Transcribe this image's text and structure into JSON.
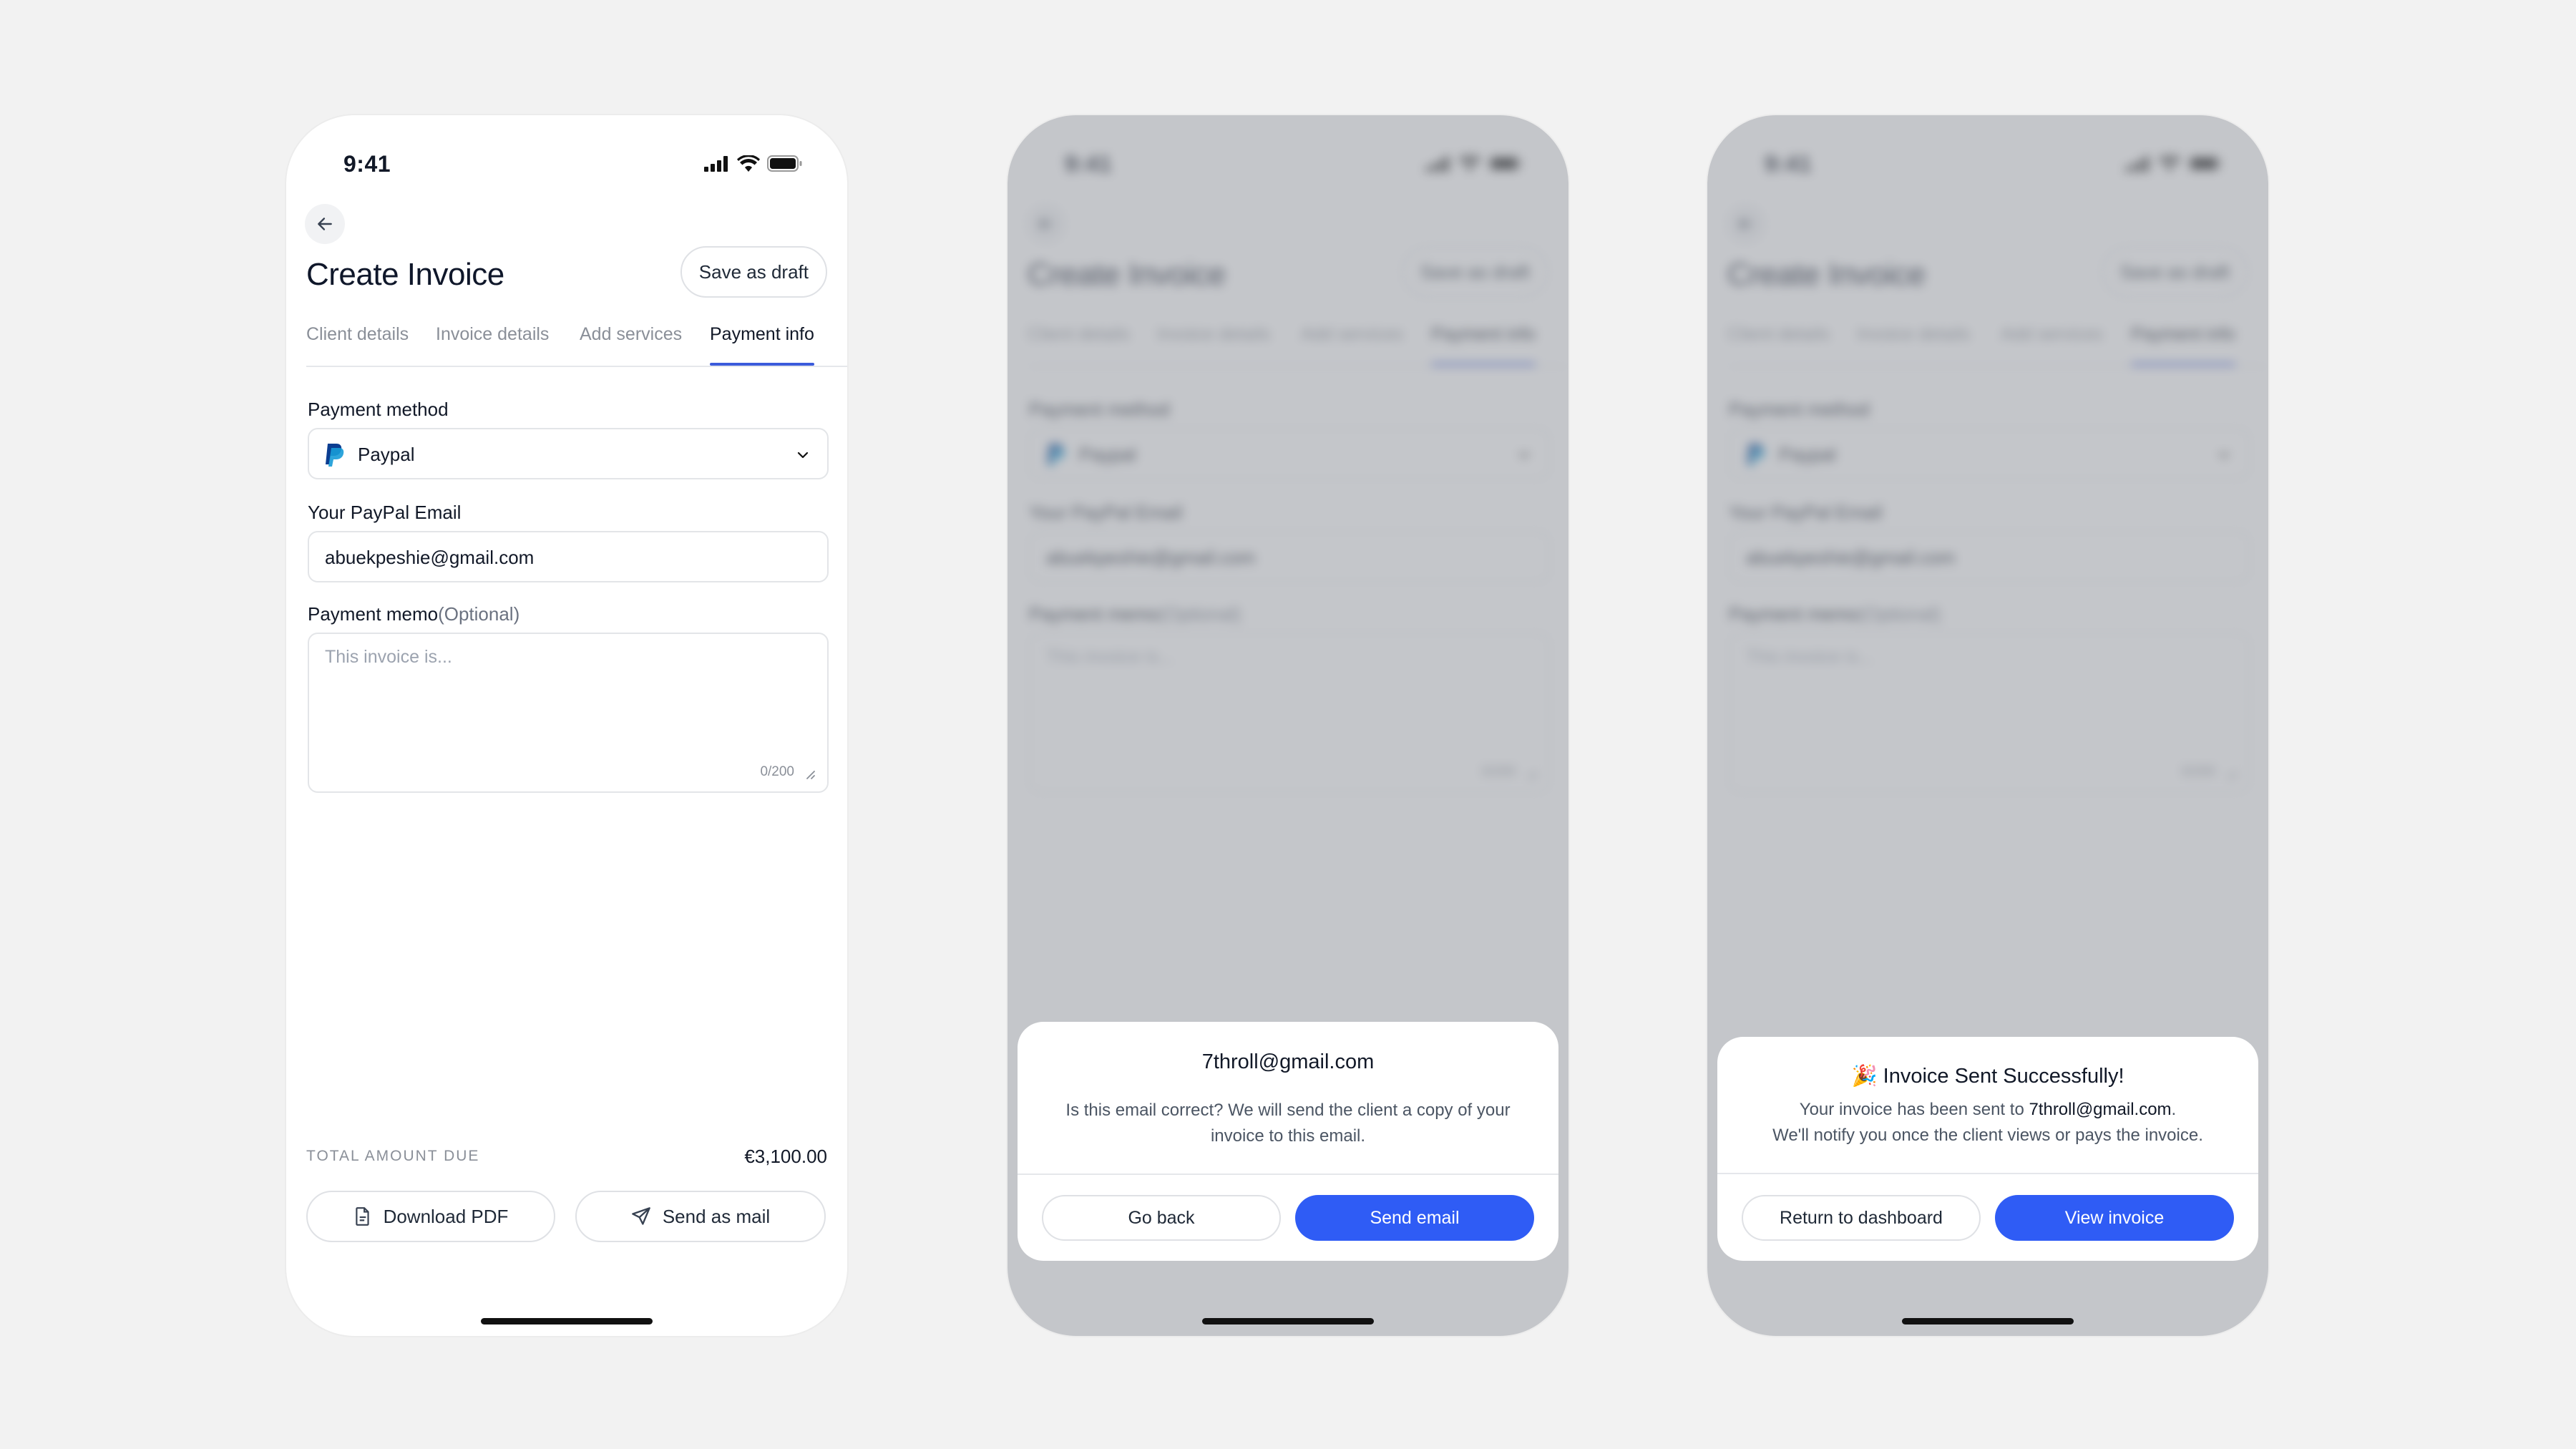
{
  "status": {
    "time": "9:41"
  },
  "screen": {
    "title": "Create Invoice",
    "draft_button": "Save as draft",
    "tabs": [
      "Client details",
      "Invoice details",
      "Add services",
      "Payment info"
    ],
    "payment_method_label": "Payment method",
    "payment_method_value": "Paypal",
    "paypal_email_label": "Your PayPal Email",
    "paypal_email_value": "abuekpeshie@gmail.com",
    "memo_label": "Payment memo",
    "memo_optional": "(Optional)",
    "memo_placeholder": "This invoice is...",
    "memo_counter": "0/200",
    "total_label": "TOTAL AMOUNT DUE",
    "total_value": "€3,100.00",
    "download_button": "Download PDF",
    "send_mail_button": "Send as mail"
  },
  "confirm_sheet": {
    "email": "7throll@gmail.com",
    "message_line1": "Is this email correct? We will send the client a copy of your",
    "message_line2": "invoice to this email.",
    "back_button": "Go back",
    "send_button": "Send email"
  },
  "success_sheet": {
    "emoji": "🎉",
    "title": "Invoice Sent Successfully!",
    "line1_prefix": "Your invoice has been sent to ",
    "line1_email": "7throll@gmail.com",
    "line1_suffix": ".",
    "line2": "We'll notify you once the client views or pays the invoice.",
    "dashboard_button": "Return to dashboard",
    "view_button": "View invoice"
  },
  "colors": {
    "primary": "#2f5cf5",
    "tab_indicator": "#3b5bdb",
    "backdrop": "#f2f2f2"
  }
}
